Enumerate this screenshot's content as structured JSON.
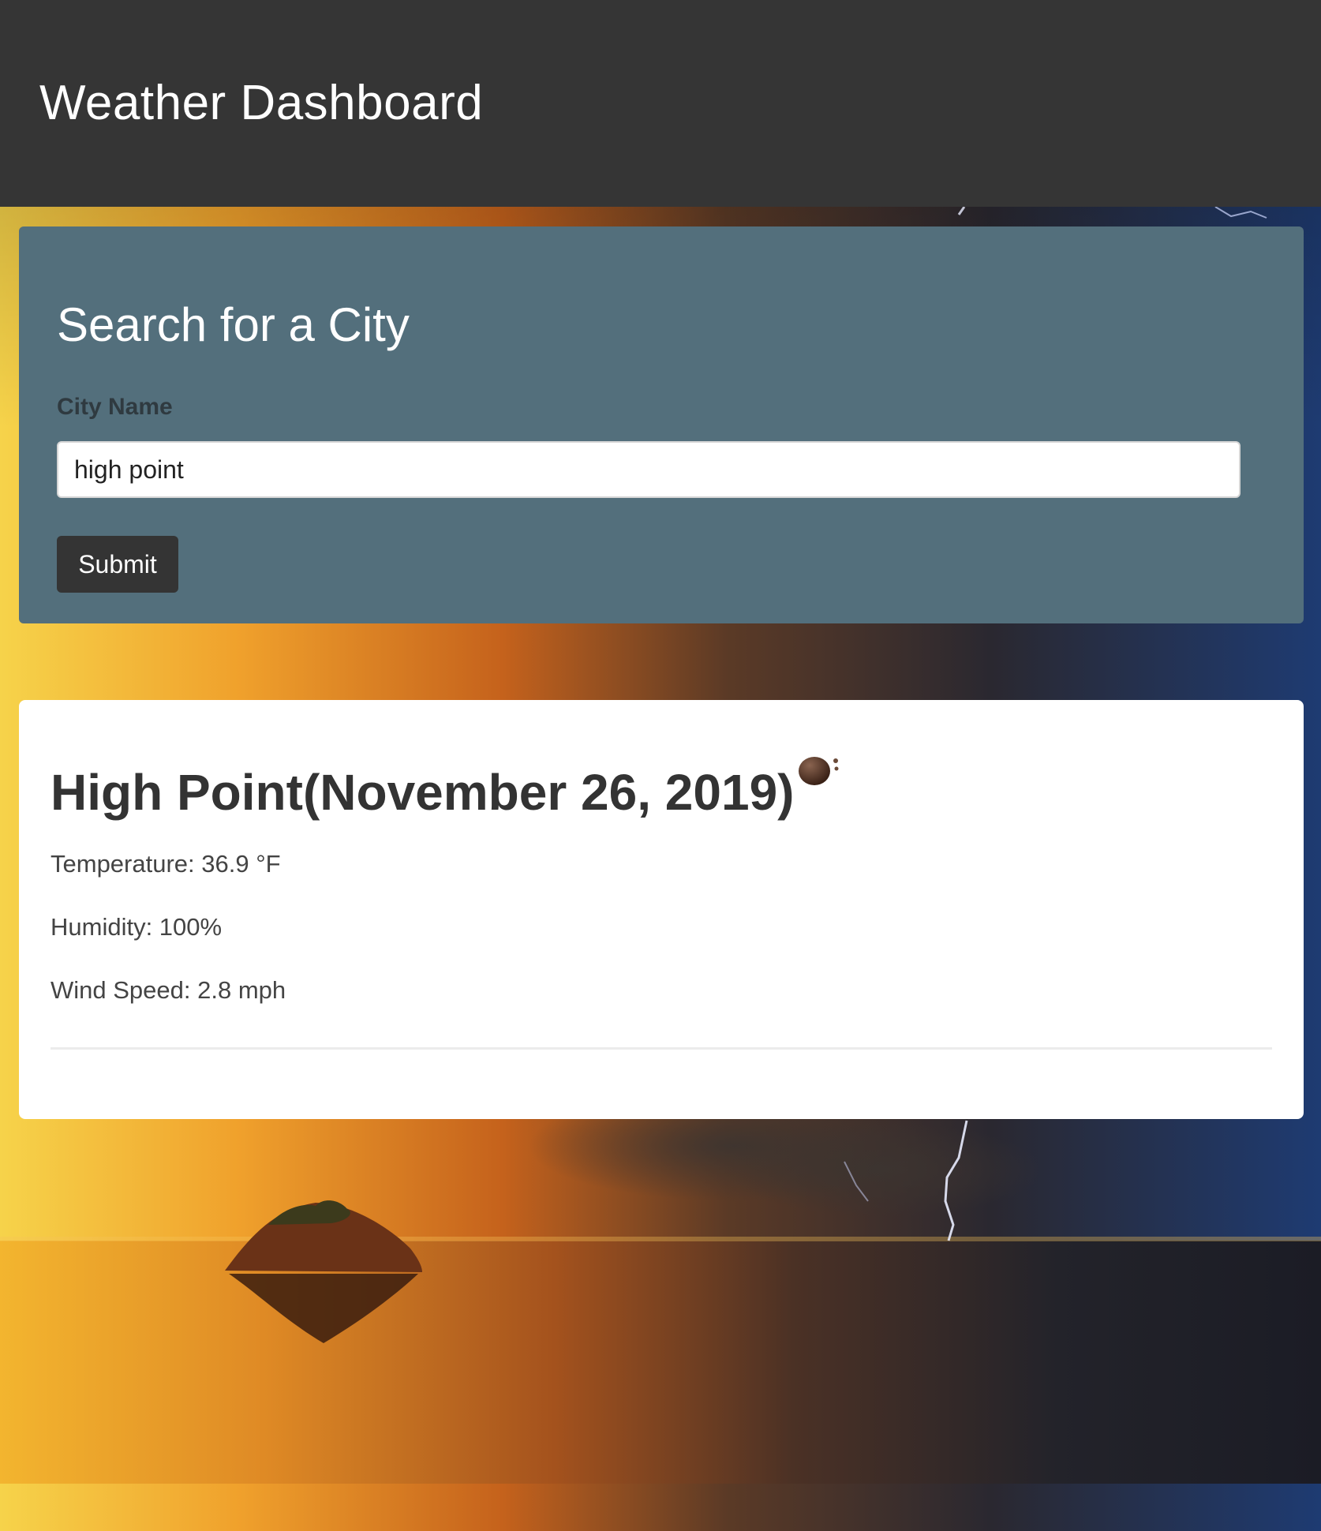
{
  "header": {
    "title": "Weather Dashboard"
  },
  "search": {
    "title": "Search for a City",
    "label": "City Name",
    "input_value": "high point",
    "submit_label": "Submit"
  },
  "weather": {
    "heading": "High Point(November 26, 2019)",
    "temperature": "Temperature: 36.9 °F",
    "humidity": "Humidity: 100%",
    "wind_speed": "Wind Speed: 2.8 mph",
    "icon": "weather-condition-icon"
  },
  "colors": {
    "header_bg": "#353535",
    "panel_bg": "#536f7c",
    "button_bg": "#343434",
    "card_bg": "#ffffff"
  }
}
